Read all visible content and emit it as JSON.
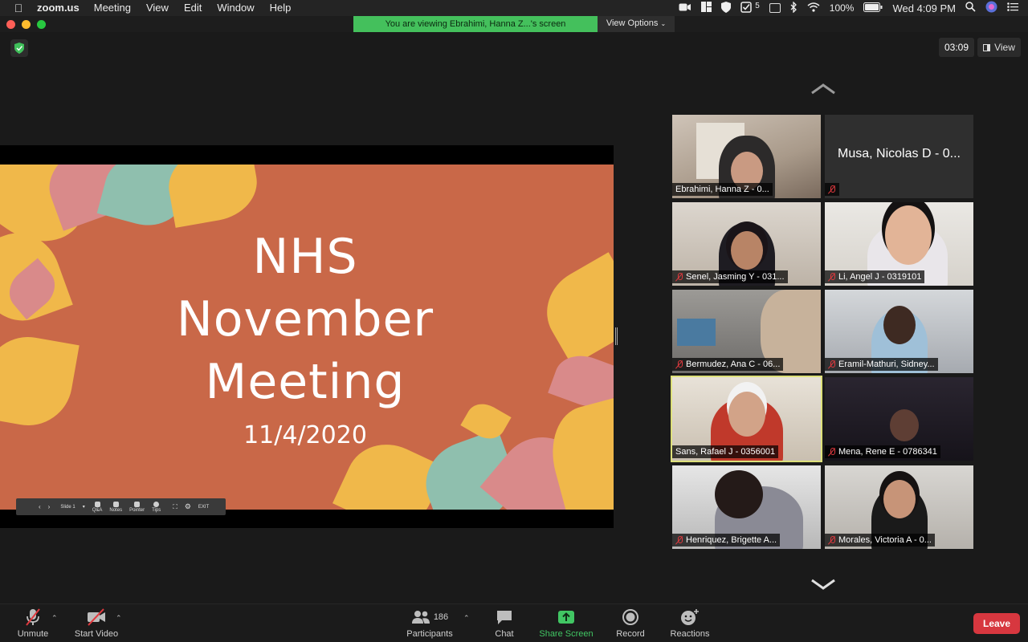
{
  "menubar": {
    "app_name": "zoom.us",
    "menus": [
      "Meeting",
      "View",
      "Edit",
      "Window",
      "Help"
    ],
    "notification_count": "5",
    "battery": "100%",
    "clock": "Wed 4:09 PM"
  },
  "banner": {
    "viewing_text": "You are viewing Ebrahimi, Hanna Z...'s screen",
    "view_options": "View Options"
  },
  "meeting": {
    "timer": "03:09",
    "view_label": "View"
  },
  "slide": {
    "title_line1": "NHS",
    "title_line2": "November",
    "title_line3": "Meeting",
    "date": "11/4/2020",
    "colors": {
      "background": "#c96848",
      "leaf_yellow": "#f0b84a",
      "leaf_teal": "#8fbfae",
      "leaf_pink": "#d98a8a"
    }
  },
  "presenter_toolbar": {
    "slide_label": "Slide 1",
    "items": [
      "Q&A",
      "Notes",
      "Pointer",
      "Tips"
    ],
    "exit": "EXIT"
  },
  "participants": [
    {
      "name": "Ebrahimi, Hanna Z - 0...",
      "video": true,
      "muted": false
    },
    {
      "name": "Musa, Nicolas D - 0...",
      "video": false,
      "muted": true
    },
    {
      "name": "Senel, Jasming Y - 031...",
      "video": true,
      "muted": true
    },
    {
      "name": "Li, Angel J - 0319101",
      "video": true,
      "muted": true
    },
    {
      "name": "Bermudez, Ana C - 06...",
      "video": true,
      "muted": true
    },
    {
      "name": "Eramil-Mathuri, Sidney...",
      "video": true,
      "muted": true
    },
    {
      "name": "Sans, Rafael J - 0356001",
      "video": true,
      "muted": false,
      "active_speaker": true
    },
    {
      "name": "Mena, Rene E - 0786341",
      "video": true,
      "muted": true
    },
    {
      "name": "Henriquez, Brigette A...",
      "video": true,
      "muted": true
    },
    {
      "name": "Morales, Victoria A - 0...",
      "video": true,
      "muted": true
    }
  ],
  "toolbar": {
    "unmute": "Unmute",
    "start_video": "Start Video",
    "participants_count": "186",
    "participants": "Participants",
    "chat": "Chat",
    "share_screen": "Share Screen",
    "record": "Record",
    "reactions": "Reactions",
    "leave": "Leave",
    "colors": {
      "share": "#41c663",
      "leave": "#d7373f"
    }
  }
}
